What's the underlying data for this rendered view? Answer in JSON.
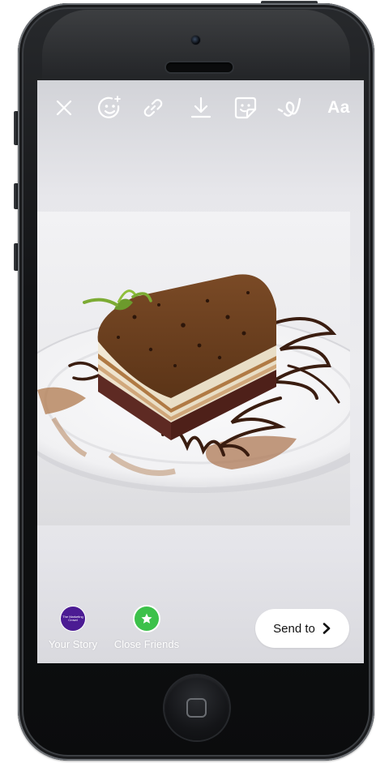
{
  "device": {
    "frame_color": "#121315",
    "screen_background": "#e8e8ec"
  },
  "toolbar": {
    "tools": [
      {
        "id": "close",
        "icon": "close-icon"
      },
      {
        "id": "face-effects",
        "icon": "face-effects-icon"
      },
      {
        "id": "link",
        "icon": "link-icon"
      },
      {
        "id": "download",
        "icon": "download-icon"
      },
      {
        "id": "sticker",
        "icon": "sticker-icon"
      },
      {
        "id": "draw",
        "icon": "draw-icon"
      },
      {
        "id": "text",
        "icon": "text-icon",
        "label": "Aa"
      }
    ],
    "icon_color": "#ffffff"
  },
  "photo": {
    "subject": "tiramisu-cake-slice-on-plate"
  },
  "bottom_bar": {
    "your_story": {
      "label": "Your Story",
      "avatar_text": "The Marketing Crowd",
      "avatar_color": "#4b1b93"
    },
    "close_friends": {
      "label": "Close Friends",
      "icon": "star-icon",
      "badge_color": "#3cc14a"
    },
    "send": {
      "label": "Send to",
      "icon": "chevron-right-icon"
    }
  }
}
